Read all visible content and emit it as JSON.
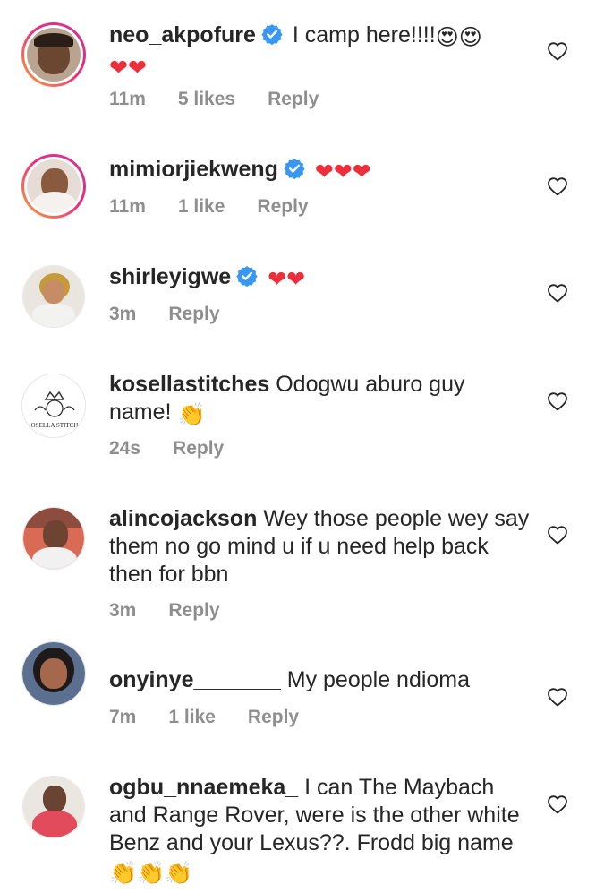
{
  "comments": [
    {
      "username": "neo_akpofure",
      "text": "I camp here!!!!",
      "trail": "😍😍",
      "line2": "❤❤",
      "time": "11m",
      "likes": "5 likes",
      "reply": "Reply"
    },
    {
      "username": "mimiorjiekweng",
      "text": "",
      "trail": "❤❤❤",
      "time": "11m",
      "likes": "1 like",
      "reply": "Reply"
    },
    {
      "username": "shirleyigwe",
      "text": "",
      "trail": "❤❤",
      "time": "3m",
      "likes": "",
      "reply": "Reply"
    },
    {
      "username": "kosellastitches",
      "text": "Odogwu aburo guy name!",
      "trail": "👏",
      "time": "24s",
      "likes": "",
      "reply": "Reply",
      "avatar_text": "OSELLA STITCH"
    },
    {
      "username": "alincojackson",
      "text": "Wey those people wey say them no go mind u if u need help back then for bbn",
      "time": "3m",
      "likes": "",
      "reply": "Reply"
    },
    {
      "username": "onyinye_______",
      "text": "My people ndioma",
      "time": "7m",
      "likes": "1 like",
      "reply": "Reply"
    },
    {
      "username": "ogbu_nnaemeka_",
      "text": "I can The Maybach and Range Rover, were is the other white Benz and your Lexus??. Frodd big name",
      "trail": "👏👏👏"
    }
  ],
  "colors": {
    "verified": "#3897f0",
    "heart": "#ed2f3b",
    "meta": "#8e8e8e"
  }
}
